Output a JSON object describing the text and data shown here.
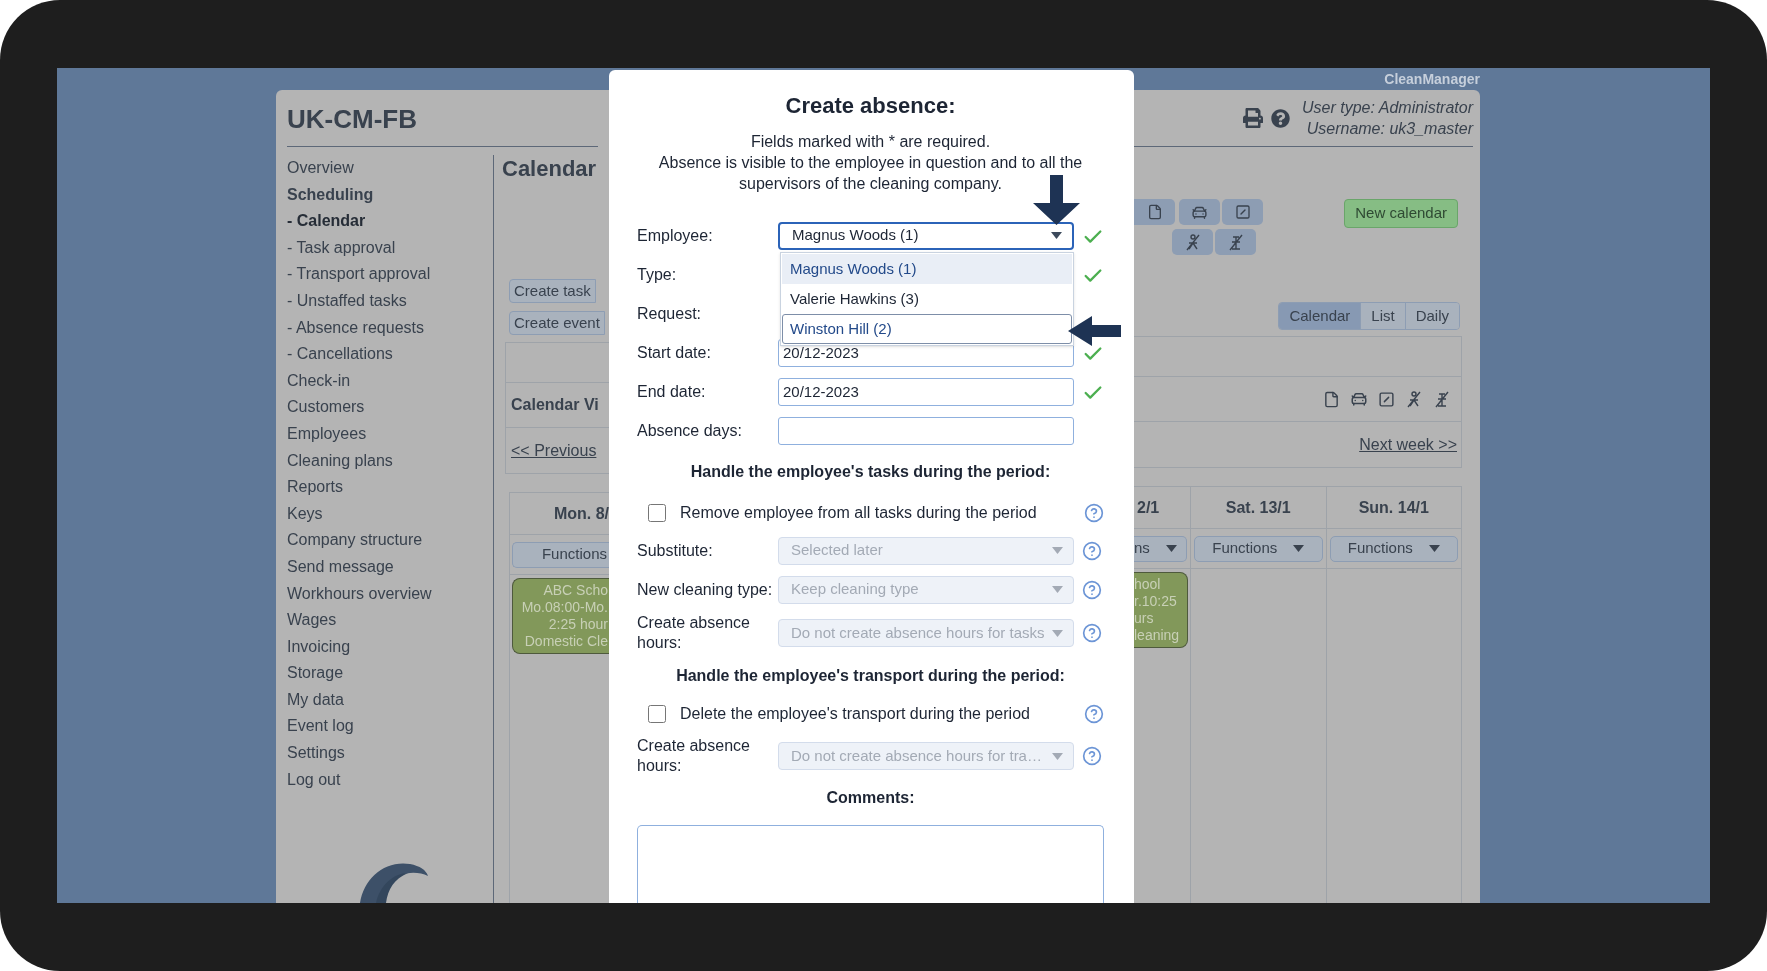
{
  "brand": "CleanManager",
  "header": {
    "title": "UK-CM-FB",
    "user_type": "User type: Administrator",
    "username": "Username: uk3_master"
  },
  "sidebar": {
    "items": [
      {
        "label": "Overview",
        "selected": false,
        "expanded": false
      },
      {
        "label": "Scheduling",
        "selected": false,
        "expanded": true,
        "children": [
          {
            "label": "- Calendar",
            "selected": true
          },
          {
            "label": "- Task approval",
            "selected": false
          },
          {
            "label": "- Transport approval",
            "selected": false
          },
          {
            "label": "- Unstaffed tasks",
            "selected": false
          },
          {
            "label": "- Absence requests",
            "selected": false
          },
          {
            "label": "- Cancellations",
            "selected": false
          }
        ]
      },
      {
        "label": "Check-in",
        "selected": false,
        "expanded": false
      },
      {
        "label": "Customers",
        "selected": false,
        "expanded": false
      },
      {
        "label": "Employees",
        "selected": false,
        "expanded": false
      },
      {
        "label": "Cleaning plans",
        "selected": false,
        "expanded": false
      },
      {
        "label": "Reports",
        "selected": false,
        "expanded": false
      },
      {
        "label": "Keys",
        "selected": false,
        "expanded": false
      },
      {
        "label": "Company structure",
        "selected": false,
        "expanded": false
      },
      {
        "label": "Send message",
        "selected": false,
        "expanded": false
      },
      {
        "label": "Workhours overview",
        "selected": false,
        "expanded": false
      },
      {
        "label": "Wages",
        "selected": false,
        "expanded": false
      },
      {
        "label": "Invoicing",
        "selected": false,
        "expanded": false
      },
      {
        "label": "Storage",
        "selected": false,
        "expanded": false
      },
      {
        "label": "My data",
        "selected": false,
        "expanded": false
      },
      {
        "label": "Event log",
        "selected": false,
        "expanded": false
      },
      {
        "label": "Settings",
        "selected": false,
        "expanded": false
      },
      {
        "label": "Log out",
        "selected": false,
        "expanded": false
      }
    ]
  },
  "calendar": {
    "title": "Calendar",
    "buttons": [
      "Create task",
      "Create event"
    ],
    "new_calendar": "New calendar",
    "view_tabs": [
      {
        "label": "Calendar",
        "selected": true
      },
      {
        "label": "List",
        "selected": false
      },
      {
        "label": "Daily",
        "selected": false
      }
    ],
    "view_title": "Calendar Vi",
    "previous": "<< Previous",
    "next": "Next week >>",
    "left_columns": [
      {
        "day": "Mon. 8/",
        "functions": "Functions",
        "events": [
          {
            "lines": [
              "ABC Scho",
              "Mo.08:00-Mo.",
              "2:25 hour",
              "Domestic Cle"
            ]
          }
        ]
      }
    ],
    "right_columns": [
      {
        "day": "2/1",
        "functions": "ns",
        "events": [
          {
            "lines": [
              "hool",
              "r.10:25",
              "urs",
              "leaning"
            ]
          }
        ]
      },
      {
        "day": "Sat. 13/1",
        "functions": "Functions"
      },
      {
        "day": "Sun. 14/1",
        "functions": "Functions"
      }
    ]
  },
  "modal": {
    "title": "Create absence:",
    "notes": [
      "Fields marked with * are required.",
      "Absence is visible to the employee in question and to all the supervisors of the cleaning company."
    ],
    "fields": [
      {
        "kind": "select",
        "label": "Employee:",
        "value": "Magnus Woods (1)",
        "valid": true,
        "options": [
          {
            "label": "Magnus Woods (1)",
            "selected": true,
            "hovered": false
          },
          {
            "label": "Valerie Hawkins (3)",
            "selected": false,
            "hovered": false
          },
          {
            "label": "Winston Hill (2)",
            "selected": false,
            "hovered": true
          }
        ]
      },
      {
        "kind": "covered",
        "label": "Type:",
        "valid": true
      },
      {
        "kind": "covered",
        "label": "Request:",
        "valid": false
      },
      {
        "kind": "text",
        "label": "Start date:",
        "value": "20/12-2023",
        "valid": true
      },
      {
        "kind": "text",
        "label": "End date:",
        "value": "20/12-2023",
        "valid": true
      },
      {
        "kind": "text",
        "label": "Absence days:",
        "valid": false
      }
    ],
    "sections": [
      {
        "heading": "Handle the employee's tasks during the period:",
        "rows": [
          {
            "kind": "checkbox",
            "label": "Remove employee from all tasks during the period",
            "checked": false
          },
          {
            "kind": "select",
            "label": "Substitute:",
            "value": "Selected later",
            "disabled": true
          },
          {
            "kind": "select",
            "label": "New cleaning type:",
            "value": "Keep cleaning type",
            "disabled": true
          },
          {
            "kind": "select",
            "label": "Create absence hours:",
            "value": "Do not create absence hours for tasks",
            "disabled": true
          }
        ]
      },
      {
        "heading": "Handle the employee's transport during the period:",
        "rows": [
          {
            "kind": "checkbox",
            "label": "Delete the employee's transport during the period",
            "checked": false
          },
          {
            "kind": "select",
            "label": "Create absence hours:",
            "value": "Do not create absence hours for tra…",
            "disabled": true
          }
        ]
      }
    ],
    "comments_label": "Comments:"
  }
}
